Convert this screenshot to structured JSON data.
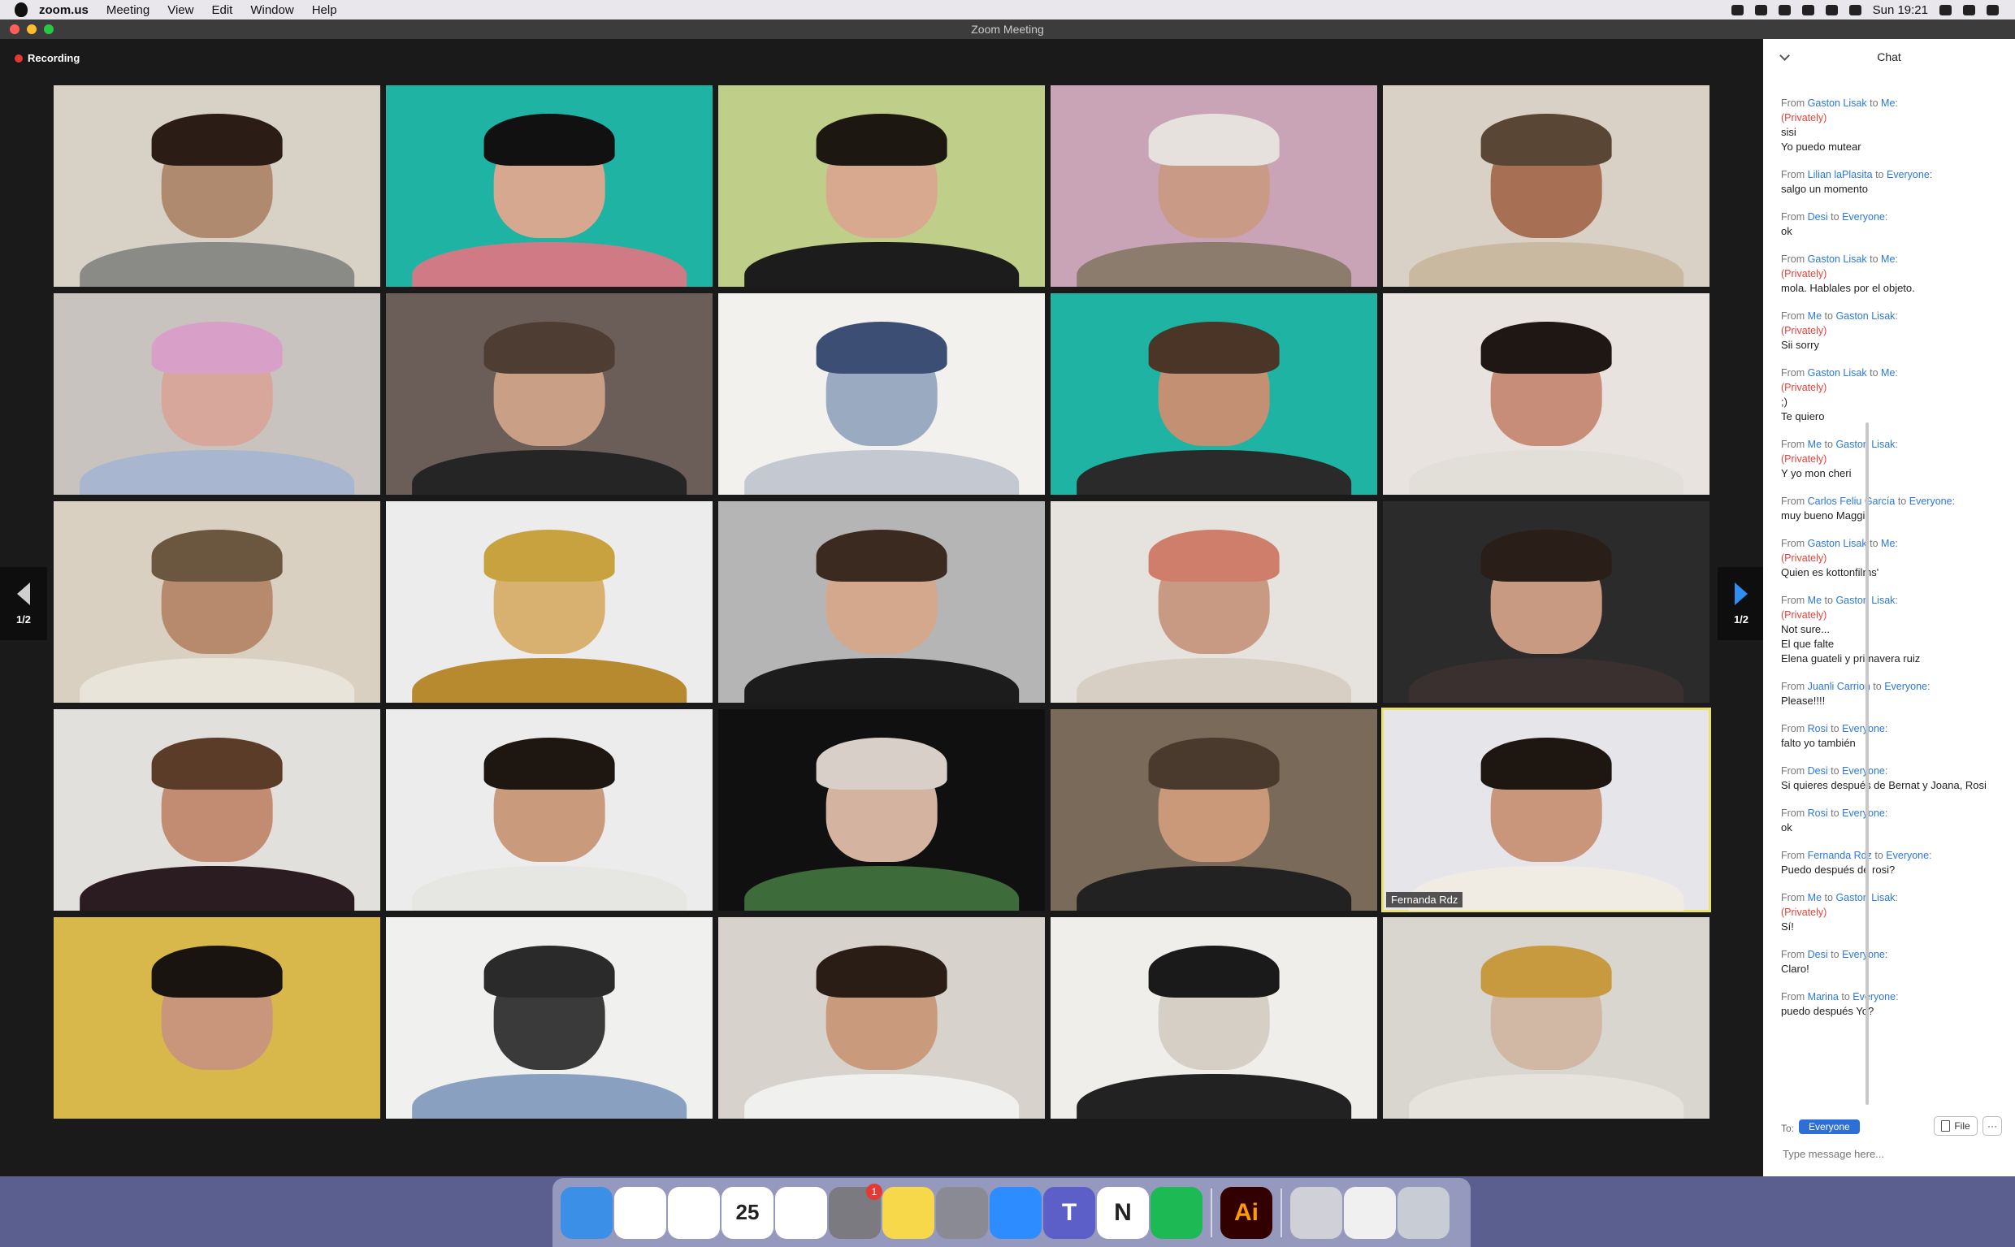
{
  "menubar": {
    "app": "zoom.us",
    "items": [
      "Meeting",
      "View",
      "Edit",
      "Window",
      "Help"
    ],
    "clock": "Sun 19:21",
    "icons": [
      "zoom-tray-icon",
      "creative-cloud-icon",
      "airplay-icon",
      "clipboard-icon",
      "bluetooth-icon",
      "wifi-icon",
      "search-icon",
      "user-icon",
      "control-center-icon"
    ]
  },
  "window": {
    "title": "Zoom Meeting"
  },
  "recording": {
    "label": "Recording",
    "color": "#e53935"
  },
  "pager": {
    "left": "1/2",
    "right": "1/2"
  },
  "tiles": [
    {
      "bg": "#d8d2c6",
      "skin": "#b08a6e",
      "hair": "#2b1d15",
      "shirt": "#8a8a86"
    },
    {
      "bg": "#1fb3a4",
      "skin": "#d7a890",
      "hair": "#111111",
      "shirt": "#d07a86"
    },
    {
      "bg": "#bfcf8a",
      "skin": "#d8a88f",
      "hair": "#1d1712",
      "shirt": "#1c1c1c"
    },
    {
      "bg": "#c8a4b6",
      "skin": "#c99b86",
      "hair": "#e6e1dc",
      "shirt": "#8b7c6e"
    },
    {
      "bg": "#d9d1c5",
      "skin": "#a77054",
      "hair": "#5a4634",
      "shirt": "#c9b9a0"
    },
    {
      "bg": "#c9c3bf",
      "skin": "#d6a79a",
      "hair": "#d8a0c8",
      "shirt": "#a8b6cf"
    },
    {
      "bg": "#6b5e59",
      "skin": "#c99f86",
      "hair": "#4e3d32",
      "shirt": "#252525"
    },
    {
      "bg": "#f2f1ee",
      "skin": "#9aaac0",
      "hair": "#3d4e75",
      "shirt": "#c4c8d0"
    },
    {
      "bg": "#1fb3a4",
      "skin": "#c39073",
      "hair": "#4a3526",
      "shirt": "#2a2a2a"
    },
    {
      "bg": "#e8e3df",
      "skin": "#c78d78",
      "hair": "#1f1713",
      "shirt": "#e2ded8"
    },
    {
      "bg": "#d9d0c2",
      "skin": "#b88a6d",
      "hair": "#6b5640",
      "shirt": "#e8e4da"
    },
    {
      "bg": "#ececec",
      "skin": "#d8b070",
      "hair": "#c9a240",
      "shirt": "#b88a30"
    },
    {
      "bg": "#b5b5b5",
      "skin": "#d3a88c",
      "hair": "#3b2a1f",
      "shirt": "#1c1c1c"
    },
    {
      "bg": "#e6e3df",
      "skin": "#c89a84",
      "hair": "#cf7e6b",
      "shirt": "#d8cfc4"
    },
    {
      "bg": "#2b2b2b",
      "skin": "#c99a82",
      "hair": "#2a1e18",
      "shirt": "#3a3030"
    },
    {
      "bg": "#e2e0dc",
      "skin": "#c28c72",
      "hair": "#5a3c28",
      "shirt": "#2a1c20"
    },
    {
      "bg": "#ececec",
      "skin": "#c99a7c",
      "hair": "#1d1611",
      "shirt": "#e6e6e2"
    },
    {
      "bg": "#101010",
      "skin": "#d4b4a0",
      "hair": "#d8d0c8",
      "shirt": "#3d6b3a"
    },
    {
      "bg": "#7a6a5a",
      "skin": "#c9997a",
      "hair": "#4a3a2e",
      "shirt": "#222222"
    },
    {
      "bg": "#e6e6ea",
      "skin": "#c9967c",
      "hair": "#1d1611",
      "shirt": "#f0ece4",
      "name": "Fernanda Rdz",
      "active": true
    },
    {
      "bg": "#d8b84a",
      "skin": "#c9967c",
      "hair": "#1a1410",
      "shirt": "#d8b84a"
    },
    {
      "bg": "#f0f0ee",
      "skin": "#3a3a3a",
      "hair": "#2a2a2a",
      "shirt": "#8aa0c0"
    },
    {
      "bg": "#d7d2cc",
      "skin": "#c99a7c",
      "hair": "#2a1d15",
      "shirt": "#f0f0ee"
    },
    {
      "bg": "#f0eeea",
      "skin": "#d6cfc6",
      "hair": "#1a1a1a",
      "shirt": "#222222"
    },
    {
      "bg": "#d9d6d0",
      "skin": "#d0b8a4",
      "hair": "#c89a40",
      "shirt": "#e6e2dc"
    }
  ],
  "chat": {
    "title": "Chat",
    "messages": [
      {
        "from": "Gaston Lisak",
        "to": "Me",
        "private": "(Privately)",
        "lines": [
          "sisi",
          "Yo puedo mutear"
        ]
      },
      {
        "from": "Lilian laPlasita",
        "to": "Everyone",
        "lines": [
          "salgo un momento"
        ]
      },
      {
        "from": "Desi",
        "to": "Everyone",
        "lines": [
          "ok"
        ]
      },
      {
        "from": "Gaston Lisak",
        "to": "Me",
        "private": "(Privately)",
        "lines": [
          "mola. Hablales por el objeto."
        ]
      },
      {
        "from": "Me",
        "to": "Gaston Lisak",
        "private": "(Privately)",
        "lines": [
          "Sii sorry"
        ]
      },
      {
        "from": "Gaston Lisak",
        "to": "Me",
        "private": "(Privately)",
        "lines": [
          ";)",
          "Te quiero"
        ]
      },
      {
        "from": "Me",
        "to": "Gaston Lisak",
        "private": "(Privately)",
        "lines": [
          "Y yo mon cheri"
        ]
      },
      {
        "from": "Carlos Feliu García",
        "to": "Everyone",
        "lines": [
          "muy bueno Maggi"
        ]
      },
      {
        "from": "Gaston Lisak",
        "to": "Me",
        "private": "(Privately)",
        "lines": [
          "Quien es kottonfilms'"
        ]
      },
      {
        "from": "Me",
        "to": "Gaston Lisak",
        "private": "(Privately)",
        "lines": [
          "Not sure...",
          "El que falte",
          "Elena guateli y primavera ruiz"
        ]
      },
      {
        "from": "Juanli Carrion",
        "to": "Everyone",
        "lines": [
          "Please!!!!"
        ]
      },
      {
        "from": "Rosi",
        "to": "Everyone",
        "lines": [
          "falto yo también"
        ]
      },
      {
        "from": "Desi",
        "to": "Everyone",
        "lines": [
          "Si quieres después de Bernat y Joana, Rosi"
        ]
      },
      {
        "from": "Rosi",
        "to": "Everyone",
        "lines": [
          "ok"
        ]
      },
      {
        "from": "Fernanda Rdz",
        "to": "Everyone",
        "lines": [
          "Puedo después de rosi?"
        ]
      },
      {
        "from": "Me",
        "to": "Gaston Lisak",
        "private": "(Privately)",
        "lines": [
          "Sí!"
        ]
      },
      {
        "from": "Desi",
        "to": "Everyone",
        "lines": [
          "Claro!"
        ]
      },
      {
        "from": "Marina",
        "to": "Everyone",
        "lines": [
          "puedo después Yo?"
        ]
      }
    ],
    "from_word": "From",
    "to_word": "to",
    "to_label": "To:",
    "recipient": "Everyone",
    "file_label": "File",
    "more_label": "···",
    "placeholder": "Type message here..."
  },
  "dock": {
    "apps": [
      {
        "name": "finder-icon",
        "color": "#3b8fe6",
        "glyph": ""
      },
      {
        "name": "chrome-icon",
        "color": "#ffffff",
        "glyph": ""
      },
      {
        "name": "photos-icon",
        "color": "#ffffff",
        "glyph": ""
      },
      {
        "name": "calendar-icon",
        "color": "#ffffff",
        "glyph": "25"
      },
      {
        "name": "reminders-icon",
        "color": "#ffffff",
        "glyph": ""
      },
      {
        "name": "system-preferences-icon",
        "color": "#7a7a80",
        "glyph": "",
        "badge": "1"
      },
      {
        "name": "notes-icon",
        "color": "#f7d84a",
        "glyph": ""
      },
      {
        "name": "launchpad-icon",
        "color": "#8a8a95",
        "glyph": ""
      },
      {
        "name": "zoom-icon",
        "color": "#2d8cff",
        "glyph": ""
      },
      {
        "name": "teams-icon",
        "color": "#5b5fc7",
        "glyph": "T"
      },
      {
        "name": "notion-icon",
        "color": "#ffffff",
        "glyph": "N"
      },
      {
        "name": "spotify-icon",
        "color": "#1db954",
        "glyph": ""
      },
      {
        "name": "illustrator-icon",
        "color": "#330000",
        "glyph": "Ai"
      },
      {
        "name": "preview-icon",
        "color": "#d0d0d8",
        "glyph": ""
      },
      {
        "name": "chrome-mail-icon",
        "color": "#f0f0f0",
        "glyph": ""
      },
      {
        "name": "trash-icon",
        "color": "#c8ccd4",
        "glyph": ""
      }
    ]
  }
}
